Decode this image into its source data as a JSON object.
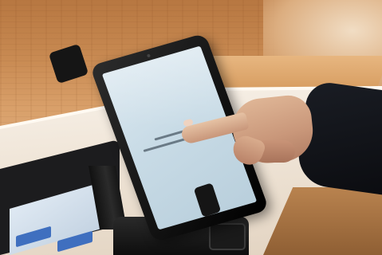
{
  "scene": {
    "subject": "tablet-kiosk",
    "colors": {
      "wood_wall": "#c88a52",
      "counter": "#efe4d6",
      "tablet_screen": "#c8dbe6",
      "tablet_bezel": "#111111",
      "terminal_button": "#3f6fbf",
      "sleeve": "#0b0c10",
      "skin": "#d2a385"
    },
    "icons": [
      "camera-icon"
    ]
  }
}
